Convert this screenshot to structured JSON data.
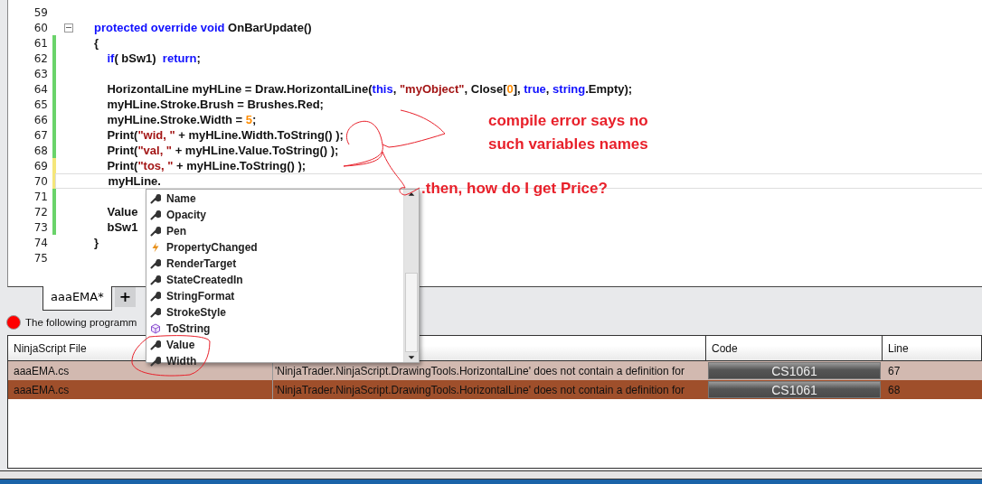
{
  "editor": {
    "lines": [
      {
        "number": "59",
        "collapsible": false,
        "current": false
      },
      {
        "number": "60",
        "collapsible": true,
        "current": false,
        "segments": [
          {
            "kind": "kw",
            "text": "protected override void"
          },
          {
            "kind": "plain",
            "text": " OnBarUpdate()"
          }
        ]
      },
      {
        "number": "61",
        "color": "#6ad36a",
        "collapsible": false,
        "current": false,
        "segments": [
          {
            "kind": "plain",
            "text": "{"
          }
        ]
      },
      {
        "number": "62",
        "color": "#6ad36a",
        "collapsible": false,
        "current": false,
        "segments": [
          {
            "kind": "kw",
            "text": "    if"
          },
          {
            "kind": "plain",
            "text": "( bSw1)  "
          },
          {
            "kind": "kw",
            "text": "return"
          },
          {
            "kind": "plain",
            "text": ";"
          }
        ]
      },
      {
        "number": "63",
        "color": "#6ad36a",
        "collapsible": false,
        "current": false
      },
      {
        "number": "64",
        "color": "#6ad36a",
        "collapsible": false,
        "current": false,
        "segments": [
          {
            "kind": "plain",
            "text": "    HorizontalLine myHLine = Draw.HorizontalLine("
          },
          {
            "kind": "kw",
            "text": "this"
          },
          {
            "kind": "plain",
            "text": ", "
          },
          {
            "kind": "str",
            "text": "\"myObject\""
          },
          {
            "kind": "plain",
            "text": ", Close["
          },
          {
            "kind": "num",
            "text": "0"
          },
          {
            "kind": "plain",
            "text": "], "
          },
          {
            "kind": "kw",
            "text": "true"
          },
          {
            "kind": "plain",
            "text": ", "
          },
          {
            "kind": "kw",
            "text": "string"
          },
          {
            "kind": "plain",
            "text": ".Empty);"
          }
        ]
      },
      {
        "number": "65",
        "color": "#6ad36a",
        "collapsible": false,
        "current": false,
        "segments": [
          {
            "kind": "plain",
            "text": "    myHLine.Stroke.Brush = Brushes.Red;"
          }
        ]
      },
      {
        "number": "66",
        "color": "#6ad36a",
        "collapsible": false,
        "current": false,
        "segments": [
          {
            "kind": "plain",
            "text": "    myHLine.Stroke.Width = "
          },
          {
            "kind": "num",
            "text": "5"
          },
          {
            "kind": "plain",
            "text": ";"
          }
        ]
      },
      {
        "number": "67",
        "color": "#6ad36a",
        "collapsible": false,
        "current": false,
        "segments": [
          {
            "kind": "plain",
            "text": "    Print("
          },
          {
            "kind": "str",
            "text": "\"wid, \""
          },
          {
            "kind": "plain",
            "text": " + myHLine.Width.ToString() );"
          }
        ]
      },
      {
        "number": "68",
        "color": "#6ad36a",
        "collapsible": false,
        "current": false,
        "segments": [
          {
            "kind": "plain",
            "text": "    Print("
          },
          {
            "kind": "str",
            "text": "\"val, \""
          },
          {
            "kind": "plain",
            "text": " + myHLine.Value.ToString() );"
          }
        ]
      },
      {
        "number": "69",
        "color": "#f5e67a",
        "collapsible": false,
        "current": false,
        "segments": [
          {
            "kind": "plain",
            "text": "    Print("
          },
          {
            "kind": "str",
            "text": "\"tos, \""
          },
          {
            "kind": "plain",
            "text": " + myHLine.ToString() );"
          }
        ]
      },
      {
        "number": "70",
        "color": "#f5e67a",
        "collapsible": false,
        "current": true,
        "segments": [
          {
            "kind": "plain",
            "text": "    myHLine."
          }
        ]
      },
      {
        "number": "71",
        "color": "#6ad36a",
        "collapsible": false,
        "current": false
      },
      {
        "number": "72",
        "color": "#6ad36a",
        "collapsible": false,
        "current": false,
        "segments": [
          {
            "kind": "plain",
            "text": "    Value"
          }
        ]
      },
      {
        "number": "73",
        "color": "#6ad36a",
        "collapsible": false,
        "current": false,
        "segments": [
          {
            "kind": "plain",
            "text": "    bSw1"
          }
        ]
      },
      {
        "number": "74",
        "collapsible": false,
        "current": false,
        "segments": [
          {
            "kind": "plain",
            "text": "}"
          }
        ]
      },
      {
        "number": "75",
        "collapsible": false,
        "current": false
      }
    ],
    "completion": {
      "items": [
        {
          "kind": "property",
          "label": "Name"
        },
        {
          "kind": "property",
          "label": "Opacity"
        },
        {
          "kind": "property",
          "label": "Pen"
        },
        {
          "kind": "event",
          "label": "PropertyChanged"
        },
        {
          "kind": "property",
          "label": "RenderTarget"
        },
        {
          "kind": "property",
          "label": "StateCreatedIn"
        },
        {
          "kind": "property",
          "label": "StringFormat"
        },
        {
          "kind": "property",
          "label": "StrokeStyle"
        },
        {
          "kind": "method",
          "label": "ToString"
        },
        {
          "kind": "property",
          "label": "Value"
        },
        {
          "kind": "property",
          "label": "Width"
        }
      ]
    },
    "annotations": [
      {
        "kind": "note",
        "text": "compile error says no"
      },
      {
        "kind": "note",
        "text": "such variables names"
      },
      {
        "kind": "question",
        "text": ".then, how do I get Price?"
      }
    ]
  },
  "tabs": [
    {
      "label": "aaaEMA*",
      "selected": true
    },
    {
      "label": "+",
      "selected": false
    }
  ],
  "status": {
    "text": "The following programm"
  },
  "table": {
    "columns": [
      "NinjaScript File",
      "Code",
      "Line"
    ],
    "rows": [
      {
        "selected": false,
        "file": "aaaEMA.cs",
        "message": "'NinjaTrader.NinjaScript.DrawingTools.HorizontalLine' does not contain a definition for",
        "code": "CS1061",
        "line": "67"
      },
      {
        "selected": true,
        "file": "aaaEMA.cs",
        "message": "'NinjaTrader.NinjaScript.DrawingTools.HorizontalLine' does not contain a definition for",
        "code": "CS1061",
        "line": "68"
      }
    ]
  }
}
